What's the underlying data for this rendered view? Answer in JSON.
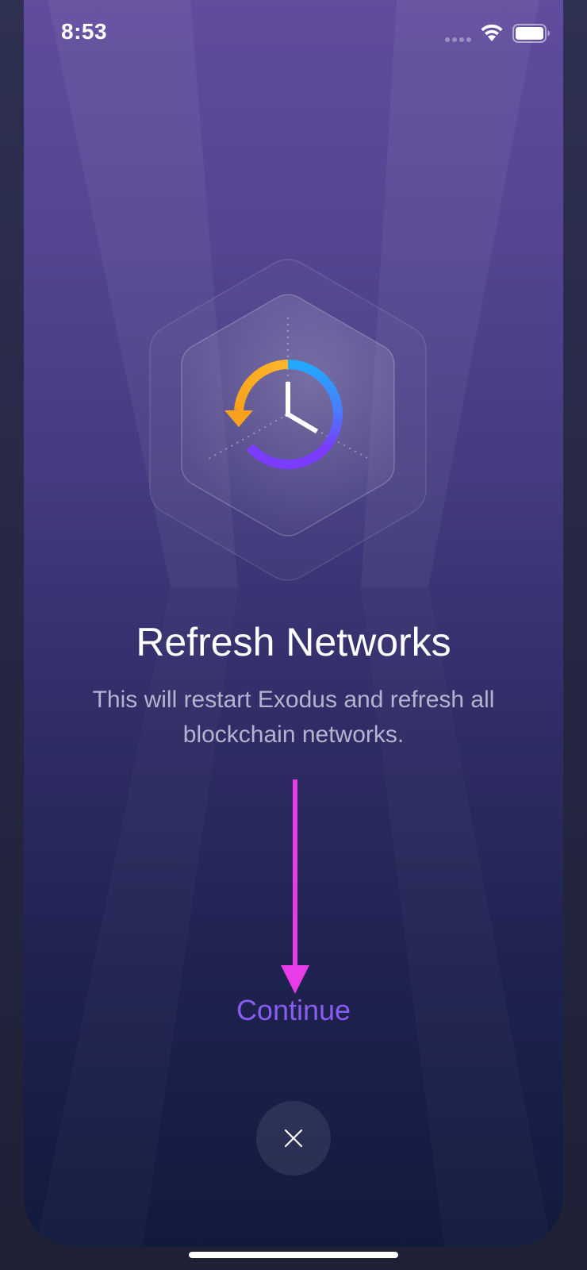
{
  "status_bar": {
    "time": "8:53",
    "signal_icon": "signal-dots-icon",
    "wifi_icon": "wifi-icon",
    "battery_icon": "battery-full-icon"
  },
  "emblem": {
    "icon": "refresh-clock-icon",
    "arc_colors": {
      "orange": "#f7a21c",
      "blue": "#22a9ff",
      "violet": "#7a3cff"
    }
  },
  "content": {
    "title": "Refresh Networks",
    "description": "This will restart Exodus and refresh all blockchain networks."
  },
  "actions": {
    "continue_label": "Continue",
    "close_icon": "close-icon"
  },
  "colors": {
    "accent": "#8a5cf0",
    "annotation_arrow": "#e83ce8",
    "background_top": "#614c9e",
    "background_bottom": "#111a3d"
  }
}
